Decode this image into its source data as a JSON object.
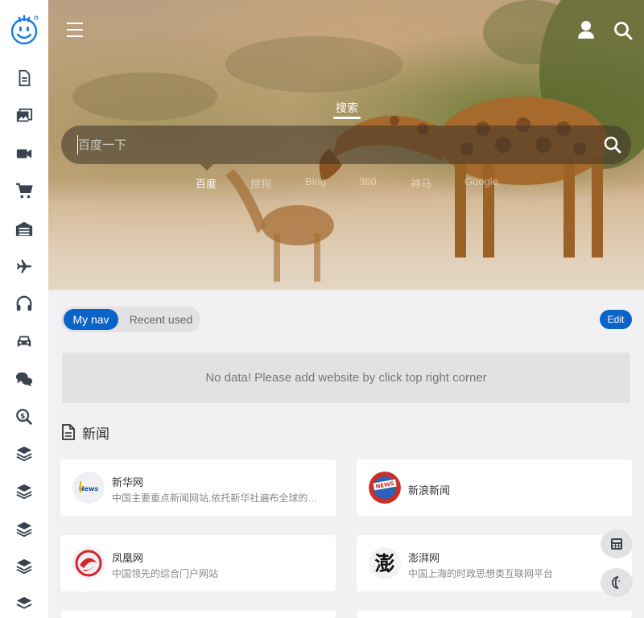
{
  "search": {
    "tab_label": "搜索",
    "placeholder": "百度一下",
    "engines": [
      "百度",
      "搜狗",
      "Bing",
      "360",
      "神马",
      "Google"
    ]
  },
  "nav": {
    "tab_mine": "My nav",
    "tab_recent": "Recent used",
    "edit_label": "Edit",
    "empty_message": "No data! Please add website by click top right corner"
  },
  "section": {
    "title": "新闻"
  },
  "cards": [
    {
      "name": "新华网",
      "desc": "中国主要重点新闻网站,依托新华社遍布全球的采编网络"
    },
    {
      "name": "新浪新闻",
      "desc": ""
    },
    {
      "name": "凤凰网",
      "desc": "中国领先的综合门户网站"
    },
    {
      "name": "澎湃网",
      "desc": "中国上海的时政思想类互联网平台"
    }
  ],
  "colors": {
    "accent": "#0a64c8",
    "sidebar_icon": "#3a4450"
  },
  "sidebar_icons": [
    "document-icon",
    "photos-icon",
    "video-icon",
    "cart-icon",
    "warehouse-icon",
    "plane-icon",
    "headphones-icon",
    "car-icon",
    "chat-icon",
    "money-search-icon",
    "layers-icon",
    "layers-icon",
    "layers-icon",
    "layers-icon",
    "layers-icon"
  ]
}
